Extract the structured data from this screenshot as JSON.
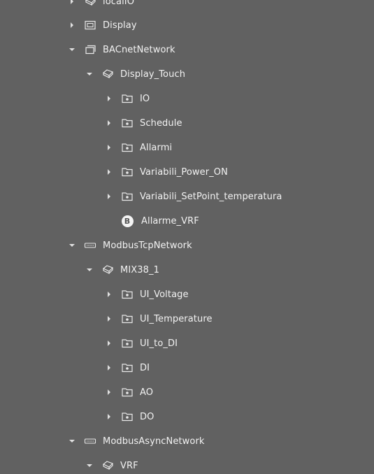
{
  "tree": {
    "local_io": "localIO",
    "display": "Display",
    "bacnet_network": "BACnetNetwork",
    "display_touch": "Display_Touch",
    "io": "IO",
    "schedule": "Schedule",
    "allarmi": "Allarmi",
    "variabili_power_on": "Variabili_Power_ON",
    "variabili_setpoint": "Variabili_SetPoint_temperatura",
    "allarme_vrf": "Allarme_VRF",
    "allarme_vrf_badge": "B",
    "modbus_tcp_network": "ModbusTcpNetwork",
    "mix38_1": "MIX38_1",
    "ui_voltage": "UI_Voltage",
    "ui_temperature": "UI_Temperature",
    "ui_to_di": "UI_to_DI",
    "di": "DI",
    "ao": "AO",
    "do": "DO",
    "modbus_async_network": "ModbusAsyncNetwork",
    "vrf": "VRF"
  },
  "colors": {
    "background": "#616161",
    "text": "#f2f2f2",
    "icon": "#e8e8e8"
  }
}
